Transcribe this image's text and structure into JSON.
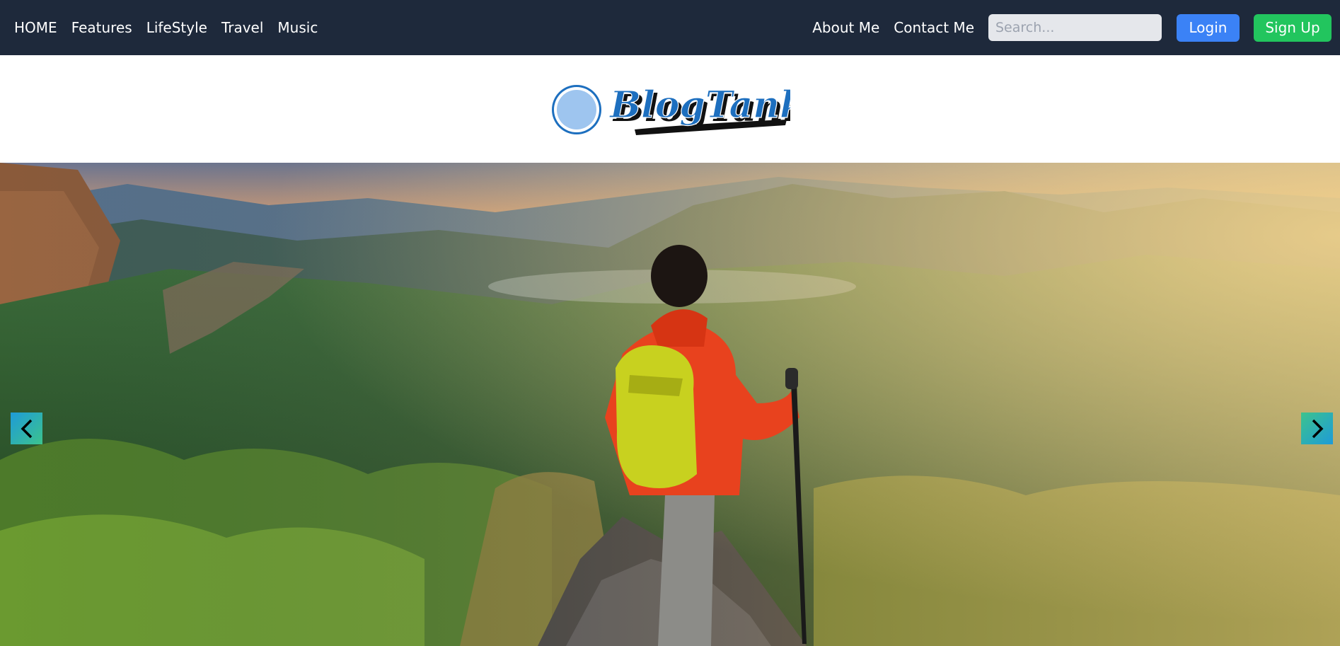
{
  "nav": {
    "left_links": [
      "HOME",
      "Features",
      "LifeStyle",
      "Travel",
      "Music"
    ],
    "right_links": [
      "About Me",
      "Contact Me"
    ],
    "search_placeholder": "Search...",
    "login_label": "Login",
    "signup_label": "Sign Up"
  },
  "brand": {
    "logo_text": "BlogTank",
    "logo_icon": "circle-logo-icon"
  },
  "hero": {
    "image": "hiker-on-mountain-peak-photo",
    "prev_icon": "chevron-left-icon",
    "next_icon": "chevron-right-icon"
  },
  "colors": {
    "navbar": "#1e293b",
    "login": "#3b82f6",
    "signup": "#22c55e",
    "logo_blue": "#1d6fbf"
  }
}
